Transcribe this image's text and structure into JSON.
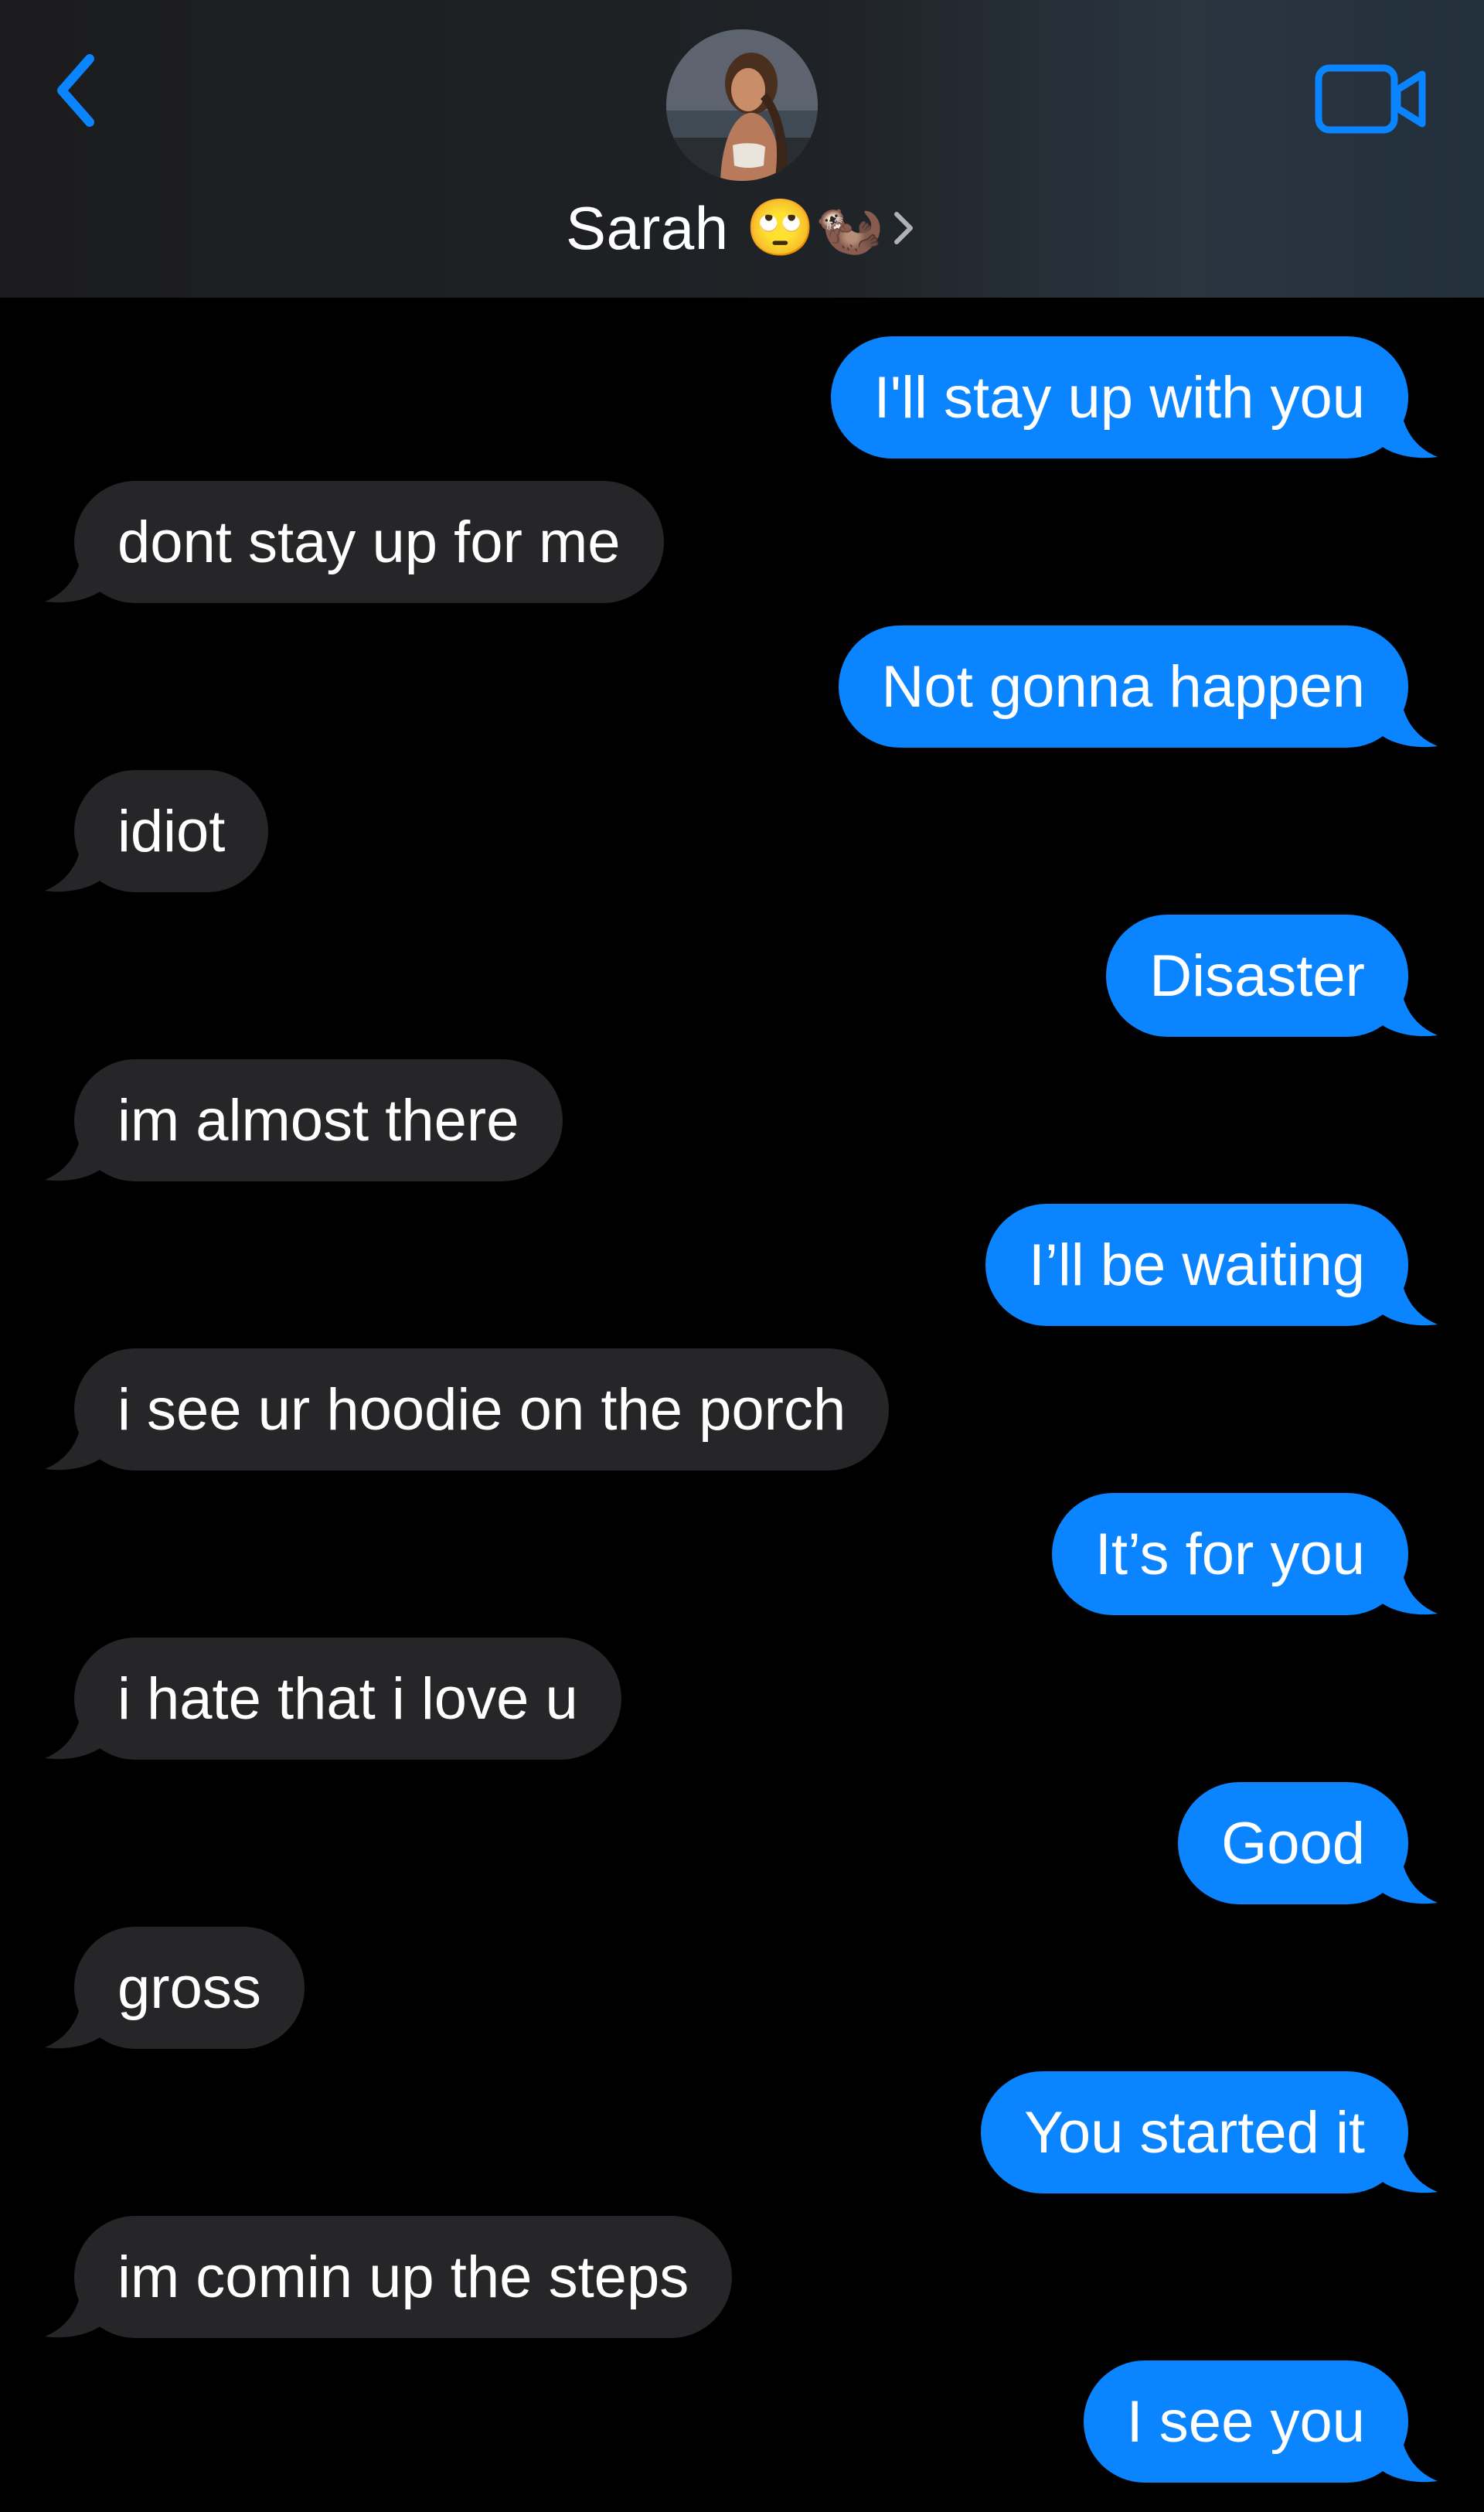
{
  "header": {
    "back_icon": "chevron-left-icon",
    "contact_name": "Sarah",
    "contact_emoji": "🙄🦦",
    "detail_chevron_icon": "chevron-right-icon",
    "video_icon": "video-camera-icon",
    "accent_color": "#0a84ff"
  },
  "thread": {
    "sent_color": "#0a84ff",
    "received_color": "#262628",
    "messages": [
      {
        "from": "me",
        "text": "I'll stay up with you"
      },
      {
        "from": "Sarah",
        "text": "dont stay up for me"
      },
      {
        "from": "me",
        "text": "Not gonna happen"
      },
      {
        "from": "Sarah",
        "text": "idiot"
      },
      {
        "from": "me",
        "text": "Disaster"
      },
      {
        "from": "Sarah",
        "text": "im almost there"
      },
      {
        "from": "me",
        "text": "I’ll be waiting"
      },
      {
        "from": "Sarah",
        "text": "i see ur hoodie on the porch"
      },
      {
        "from": "me",
        "text": "It’s for you"
      },
      {
        "from": "Sarah",
        "text": "i hate that i love u"
      },
      {
        "from": "me",
        "text": "Good"
      },
      {
        "from": "Sarah",
        "text": "gross"
      },
      {
        "from": "me",
        "text": "You started it"
      },
      {
        "from": "Sarah",
        "text": "im comin up the steps"
      },
      {
        "from": "me",
        "text": "I see you"
      }
    ]
  }
}
